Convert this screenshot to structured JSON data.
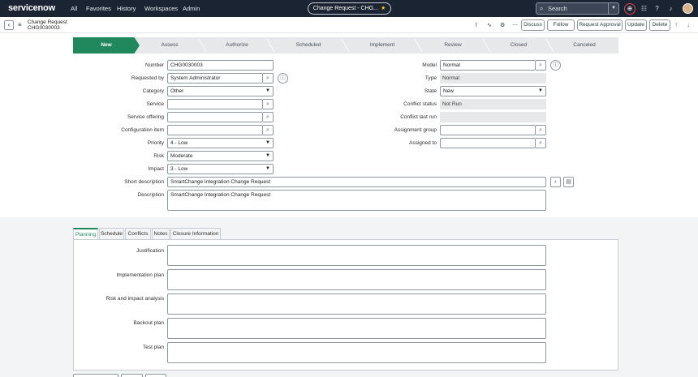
{
  "topnav": {
    "logo": "servicenow",
    "links": [
      "All",
      "Favorites",
      "History",
      "Workspaces",
      "Admin"
    ],
    "context_pill": "Change Request - CHG...",
    "search_placeholder": "Search",
    "icons": [
      "search-icon",
      "chevron-down-icon",
      "globe-icon",
      "chat-icon",
      "help-icon",
      "bell-icon",
      "avatar"
    ]
  },
  "header": {
    "record_type": "Change Request",
    "record_number": "CHG0030003",
    "buttons": [
      "Discuss",
      "Follow",
      "Request Approval",
      "Update",
      "Delete"
    ],
    "icons": [
      "paperclip-icon",
      "activity-icon",
      "settings-icon",
      "more-icon",
      "arrow-up-icon",
      "arrow-down-icon"
    ]
  },
  "stages": [
    "New",
    "Assess",
    "Authorize",
    "Scheduled",
    "Implement",
    "Review",
    "Closed",
    "Canceled"
  ],
  "active_stage": "New",
  "form": {
    "left": {
      "number_label": "Number",
      "number_value": "CHG0030003",
      "requested_by_label": "Requested by",
      "requested_by_value": "System Administrator",
      "category_label": "Category",
      "category_value": "Other",
      "service_label": "Service",
      "service_value": "",
      "service_offering_label": "Service offering",
      "service_offering_value": "",
      "configuration_item_label": "Configuration item",
      "configuration_item_value": "",
      "priority_label": "Priority",
      "priority_value": "4 - Low",
      "risk_label": "Risk",
      "risk_value": "Moderate",
      "impact_label": "Impact",
      "impact_value": "3 - Low"
    },
    "right": {
      "model_label": "Model",
      "model_value": "Normal",
      "type_label": "Type",
      "type_value": "Normal",
      "state_label": "State",
      "state_value": "New",
      "conflict_status_label": "Conflict status",
      "conflict_status_value": "Not Run",
      "conflict_last_run_label": "Conflict last run",
      "conflict_last_run_value": "",
      "assignment_group_label": "Assignment group",
      "assignment_group_value": "",
      "assigned_to_label": "Assigned to",
      "assigned_to_value": ""
    },
    "short_description_label": "Short description",
    "short_description_value": "SmartChange Integration Change Request",
    "description_label": "Description",
    "description_value": "SmartChange Integration Change Request"
  },
  "tabs": [
    "Planning",
    "Schedule",
    "Conflicts",
    "Notes",
    "Closure Information"
  ],
  "active_tab": "Planning",
  "planning": {
    "justification_label": "Justification",
    "implementation_plan_label": "Implementation plan",
    "risk_impact_label": "Risk and impact analysis",
    "backout_plan_label": "Backout plan",
    "test_plan_label": "Test plan"
  },
  "colors": {
    "topnav_bg": "#1b2433",
    "active_stage": "#21875d",
    "logo_accent": "#62d84e"
  }
}
